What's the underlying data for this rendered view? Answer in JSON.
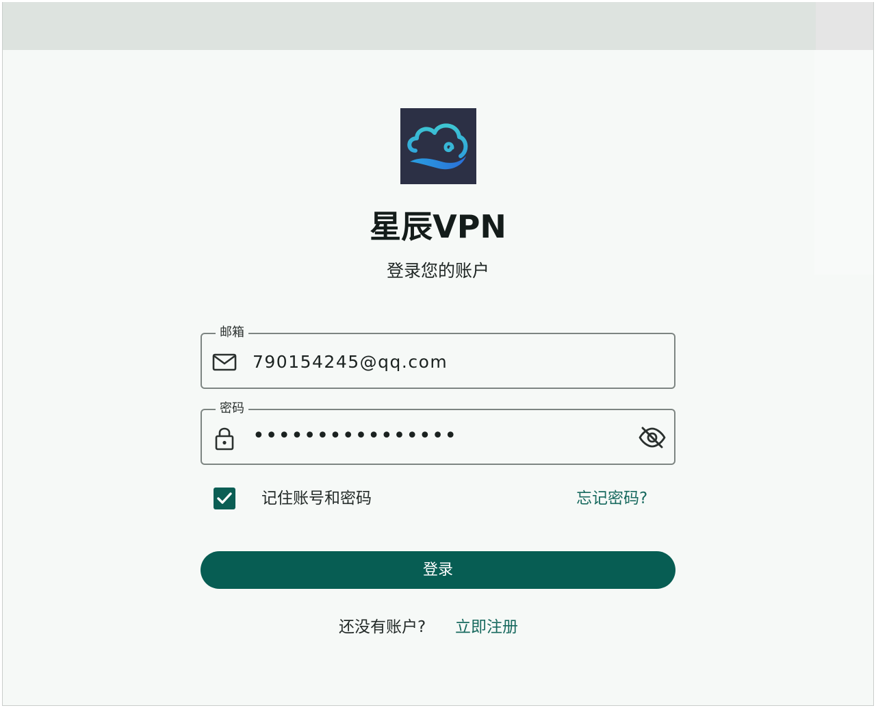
{
  "app": {
    "name": "星辰VPN",
    "subtitle": "登录您的账户"
  },
  "logo": {
    "icon": "cloud-wave-icon",
    "background": "#2c3045",
    "accent_top": "#3ec5d2",
    "accent_bottom": "#2a7de0"
  },
  "form": {
    "email": {
      "label": "邮箱",
      "value": "790154245@qq.com",
      "icon": "mail-icon"
    },
    "password": {
      "label": "密码",
      "masked_value": "••••••••••••••••",
      "icon": "lock-icon",
      "toggle_icon": "eye-off-icon"
    },
    "remember": {
      "label": "记住账号和密码",
      "checked": true
    },
    "forgot_label": "忘记密码?",
    "submit_label": "登录"
  },
  "footer": {
    "prompt": "还没有账户?",
    "register_label": "立即注册"
  },
  "colors": {
    "primary": "#075d53",
    "link": "#17695e",
    "page_background": "#f6f9f7"
  }
}
